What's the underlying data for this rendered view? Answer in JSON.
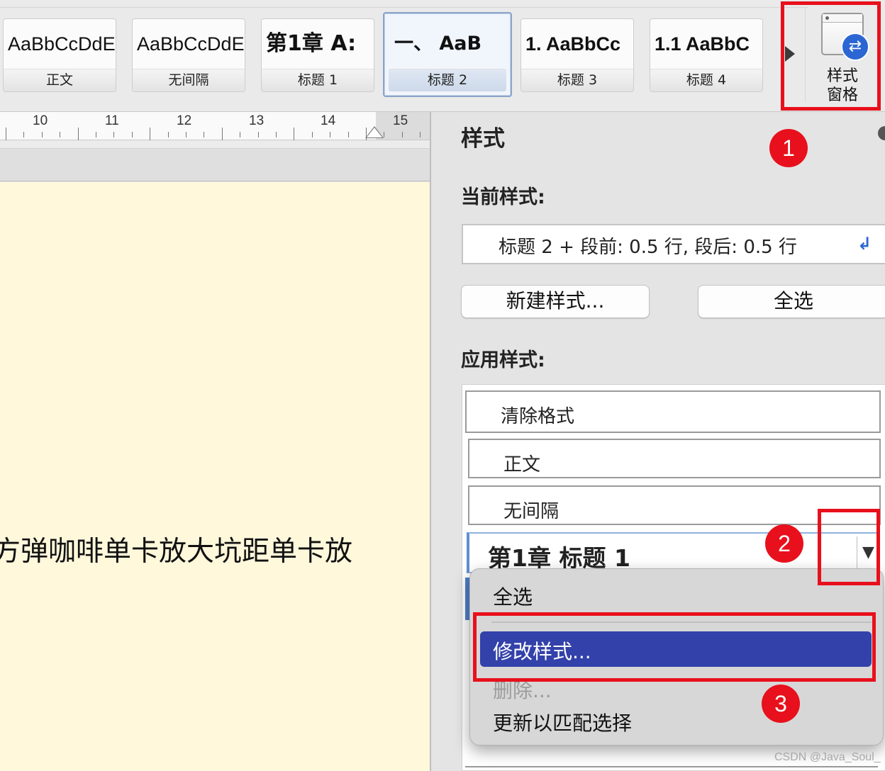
{
  "ribbon": {
    "styles": [
      {
        "preview": "AaBbCcDdE",
        "name": "正文"
      },
      {
        "preview": "AaBbCcDdE",
        "name": "无间隔"
      },
      {
        "preview": "第1章  A:",
        "name": "标题 1"
      },
      {
        "preview": "一、    AaB",
        "name": "标题 2",
        "selected": true
      },
      {
        "preview": "1.  AaBbCc",
        "name": "标题 3"
      },
      {
        "preview": "1.1  AaBbC",
        "name": "标题 4"
      }
    ],
    "styles_pane_button": {
      "label": "样式\n窗格",
      "icon": "styles-pane-icon"
    }
  },
  "ruler": {
    "numbers": [
      "10",
      "11",
      "12",
      "13",
      "14",
      "15"
    ]
  },
  "document": {
    "text": "方弹咖啡单卡放大坑距单卡放"
  },
  "pane": {
    "title": "样式",
    "current_style_label": "当前样式:",
    "current_style_value": "标题 2 + 段前: 0.5 行, 段后: 0.5 行",
    "new_style_button": "新建样式...",
    "select_all_button": "全选",
    "apply_style_label": "应用样式:",
    "style_list": [
      "清除格式",
      "正文",
      "无间隔",
      "第1章  标题 1"
    ]
  },
  "context_menu": {
    "items": [
      "全选",
      "修改样式...",
      "删除...",
      "更新以匹配选择"
    ],
    "highlighted": "修改样式..."
  },
  "annotations": {
    "badges": [
      "1",
      "2",
      "3"
    ],
    "color": "#e8101c"
  },
  "watermark": "CSDN @Java_Soul_"
}
